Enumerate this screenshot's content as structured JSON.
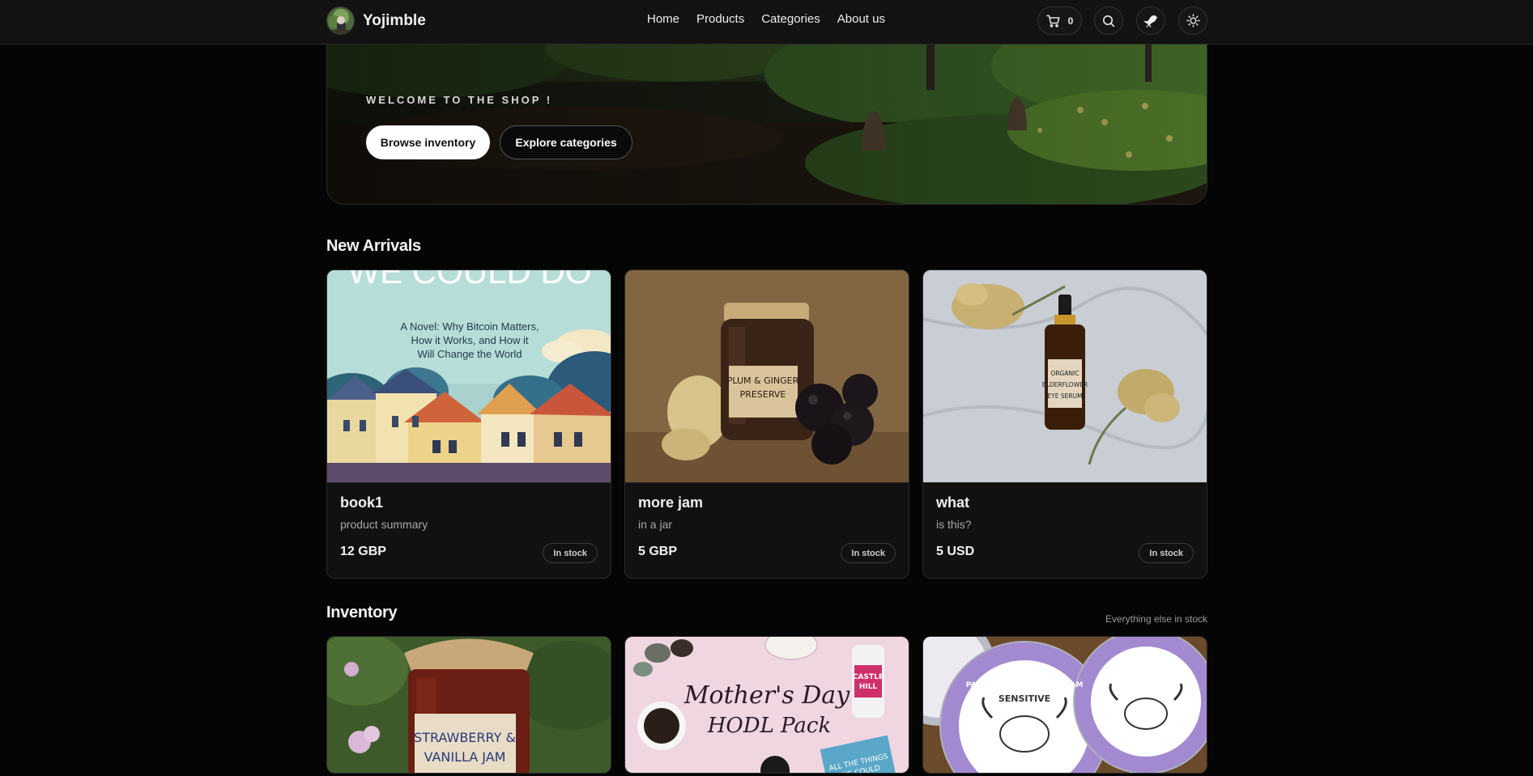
{
  "brand": {
    "name": "Yojimble",
    "logo_icon": "avatar-garden-logo"
  },
  "nav": [
    "Home",
    "Products",
    "Categories",
    "About us"
  ],
  "header_actions": {
    "cart_count": "0",
    "cart_icon": "cart-icon",
    "search_icon": "search-icon",
    "bird_icon": "bird-icon",
    "theme_icon": "sun-icon"
  },
  "hero": {
    "welcome": "WELCOME TO THE SHOP !",
    "browse_label": "Browse inventory",
    "explore_label": "Explore categories"
  },
  "new_arrivals": {
    "title": "New Arrivals",
    "items": [
      {
        "name": "book1",
        "summary": "product summary",
        "price": "12 GBP",
        "stock": "In stock",
        "cover_title": "WE COULD DO",
        "cover_lines": [
          "A Novel: Why Bitcoin Matters,",
          "How it Works, and How it",
          "Will Change the World"
        ]
      },
      {
        "name": "more jam",
        "summary": "in a jar",
        "price": "5 GBP",
        "stock": "In stock",
        "label_lines": [
          "PLUM & GINGER",
          "PRESERVE"
        ]
      },
      {
        "name": "what",
        "summary": "is this?",
        "price": "5 USD",
        "stock": "In stock",
        "label_lines": [
          "ORGANIC",
          "ELDERFLOWER",
          "EYE SERUM"
        ]
      }
    ]
  },
  "inventory": {
    "title": "Inventory",
    "note": "Everything else in stock",
    "images": [
      {
        "label_lines": [
          "STRAWBERRY &",
          "VANILLA JAM"
        ]
      },
      {
        "label_lines": [
          "Mother's Day",
          "HODL Pack"
        ],
        "extra": [
          "CASTLE",
          "HILL"
        ],
        "book": [
          "ALL THE THINGS",
          "WE COULD"
        ]
      },
      {
        "label_lines": [
          "PASTURE FED TALLOW BALM",
          "SENSITIVE"
        ]
      }
    ]
  },
  "colors": {
    "background": "#050505",
    "header": "#121212",
    "card": "#111111",
    "accent": "#ffffff"
  }
}
